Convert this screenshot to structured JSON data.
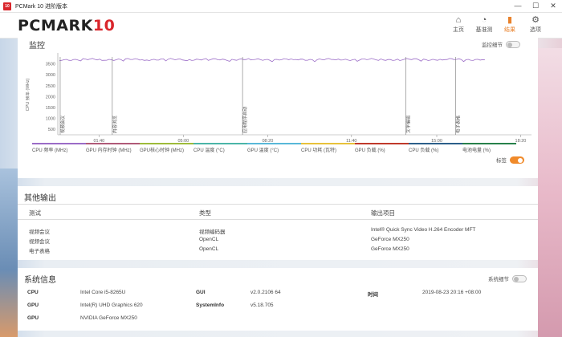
{
  "window": {
    "title": "PCMark 10 进阶版本",
    "app_icon": "10"
  },
  "header": {
    "logo_text": "PCMARK",
    "logo_num": "10"
  },
  "nav": [
    {
      "label": "主页",
      "icon": "home-icon",
      "glyph": "⌂"
    },
    {
      "label": "基准测试",
      "icon": "gauge-icon",
      "glyph": "◔"
    },
    {
      "label": "结果",
      "icon": "bar-chart-icon",
      "glyph": "▮",
      "active": true
    },
    {
      "label": "选项",
      "icon": "gear-icon",
      "glyph": "⚙"
    }
  ],
  "monitor": {
    "title": "监控",
    "toggle_label": "监控细节",
    "markers_toggle_label": "标签",
    "ylabel": "CPU 频率 (MHz)",
    "chart_data": {
      "type": "line",
      "y_ticks": [
        "3500",
        "3000",
        "2500",
        "2000",
        "1500",
        "1000",
        "500"
      ],
      "x_ticks": [
        "01:40",
        "05:00",
        "08:20",
        "11:40",
        "15:00",
        "18:20"
      ],
      "markers": [
        "视频会议",
        "内容浏览",
        "应用程序启动",
        "文字编辑",
        "电子表格"
      ],
      "series": [
        {
          "name": "CPU 频率 (MHz)",
          "value_approx": 3700,
          "color": "#9b6cc7"
        }
      ]
    },
    "legend": [
      {
        "label": "CPU 频率 (MHz)",
        "color": "#9b6cc7"
      },
      {
        "label": "GPU 内存时钟 (MHz)",
        "color": "#b05a78"
      },
      {
        "label": "GPU核心时钟 (MHz)",
        "color": "#9ebb3a"
      },
      {
        "label": "CPU 温度 (°C)",
        "color": "#4ab5a8"
      },
      {
        "label": "GPU 温度 (°C)",
        "color": "#58b8d8"
      },
      {
        "label": "CPU 功耗 (瓦特)",
        "color": "#e8c23a"
      },
      {
        "label": "GPU 负载 (%)",
        "color": "#c0392b"
      },
      {
        "label": "CPU 负载 (%)",
        "color": "#2c5f8a"
      },
      {
        "label": "电池电量 (%)",
        "color": "#27814a"
      }
    ]
  },
  "other_output": {
    "title": "其他输出",
    "columns": [
      "测试",
      "类型",
      "输出项目"
    ],
    "rows": [
      [
        "视频会议",
        "视频编码器",
        "Intel® Quick Sync Video H.264 Encoder MFT"
      ],
      [
        "视频会议",
        "OpenCL",
        "GeForce MX250"
      ],
      [
        "电子表格",
        "OpenCL",
        "GeForce MX250"
      ]
    ]
  },
  "system_info": {
    "title": "系统信息",
    "toggle_label": "系统细节",
    "cpu_label": "CPU",
    "cpu_value": "Intel Core i5-8265U",
    "gpu1_label": "GPU",
    "gpu1_value": "Intel(R) UHD Graphics 620",
    "gpu2_label": "GPU",
    "gpu2_value": "NVIDIA GeForce MX250",
    "gui_label": "GUI",
    "gui_value": "v2.0.2106 64",
    "sysinfo_label": "SystemInfo",
    "sysinfo_value": "v5.18.705",
    "time_label": "时间",
    "time_value": "2019-08-23 20:16 +08:00"
  }
}
